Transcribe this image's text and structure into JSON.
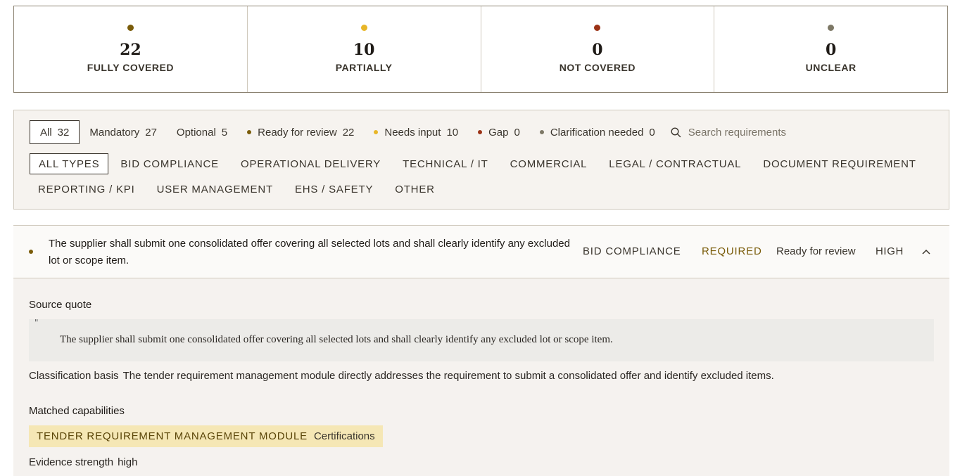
{
  "stats": [
    {
      "count": "22",
      "label": "FULLY COVERED",
      "color": "#7a5c0a"
    },
    {
      "count": "10",
      "label": "PARTIALLY",
      "color": "#e8b628"
    },
    {
      "count": "0",
      "label": "NOT COVERED",
      "color": "#9b3216"
    },
    {
      "count": "0",
      "label": "UNCLEAR",
      "color": "#7d7866"
    }
  ],
  "filters": {
    "all": {
      "label": "All",
      "count": "32"
    },
    "mandatory": {
      "label": "Mandatory",
      "count": "27"
    },
    "optional": {
      "label": "Optional",
      "count": "5"
    },
    "ready": {
      "label": "Ready for review",
      "count": "22",
      "color": "#7a5c0a"
    },
    "needs_input": {
      "label": "Needs input",
      "count": "10",
      "color": "#e8b628"
    },
    "gap": {
      "label": "Gap",
      "count": "0",
      "color": "#9b3216"
    },
    "clarification": {
      "label": "Clarification needed",
      "count": "0",
      "color": "#7d7866"
    },
    "search_placeholder": "Search requirements"
  },
  "types_row1": [
    "ALL TYPES",
    "BID COMPLIANCE",
    "OPERATIONAL DELIVERY",
    "TECHNICAL / IT",
    "COMMERCIAL",
    "LEGAL / CONTRACTUAL",
    "DOCUMENT REQUIREMENT"
  ],
  "types_row2": [
    "REPORTING / KPI",
    "USER MANAGEMENT",
    "EHS / SAFETY",
    "OTHER"
  ],
  "requirement": {
    "text": "The supplier shall submit one consolidated offer covering all selected lots and shall clearly identify any excluded lot or scope item.",
    "category": "BID COMPLIANCE",
    "required": "REQUIRED",
    "status": "Ready for review",
    "priority": "HIGH",
    "detail": {
      "source_label": "Source quote",
      "quote_mark": "\"",
      "quote": "The supplier shall submit one consolidated offer covering all selected lots and shall clearly identify any excluded lot or scope item.",
      "basis_label": "Classification basis",
      "basis": "The tender requirement management module directly addresses the requirement to submit a consolidated offer and identify excluded items.",
      "matched_label": "Matched capabilities",
      "capability_name": "TENDER REQUIREMENT MANAGEMENT MODULE",
      "capability_tag": "Certifications",
      "evidence_label": "Evidence strength",
      "evidence": "high"
    }
  }
}
